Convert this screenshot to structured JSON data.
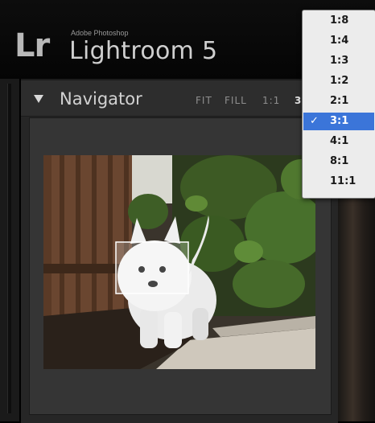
{
  "app": {
    "brand_mark": "Lr",
    "brand_small": "Adobe Photoshop",
    "title": "Lightroom 5"
  },
  "navigator": {
    "title": "Navigator",
    "zoom_options": [
      "FIT",
      "FILL",
      "1:1",
      "3:1"
    ],
    "active_zoom": "3:1"
  },
  "zoom_menu": {
    "items": [
      "1:8",
      "1:4",
      "1:3",
      "1:2",
      "2:1",
      "3:1",
      "4:1",
      "8:1",
      "11:1"
    ],
    "selected": "3:1",
    "check_mark": "✓"
  },
  "colors": {
    "menu_highlight": "#3b75d9",
    "panel_bg": "#262626"
  }
}
